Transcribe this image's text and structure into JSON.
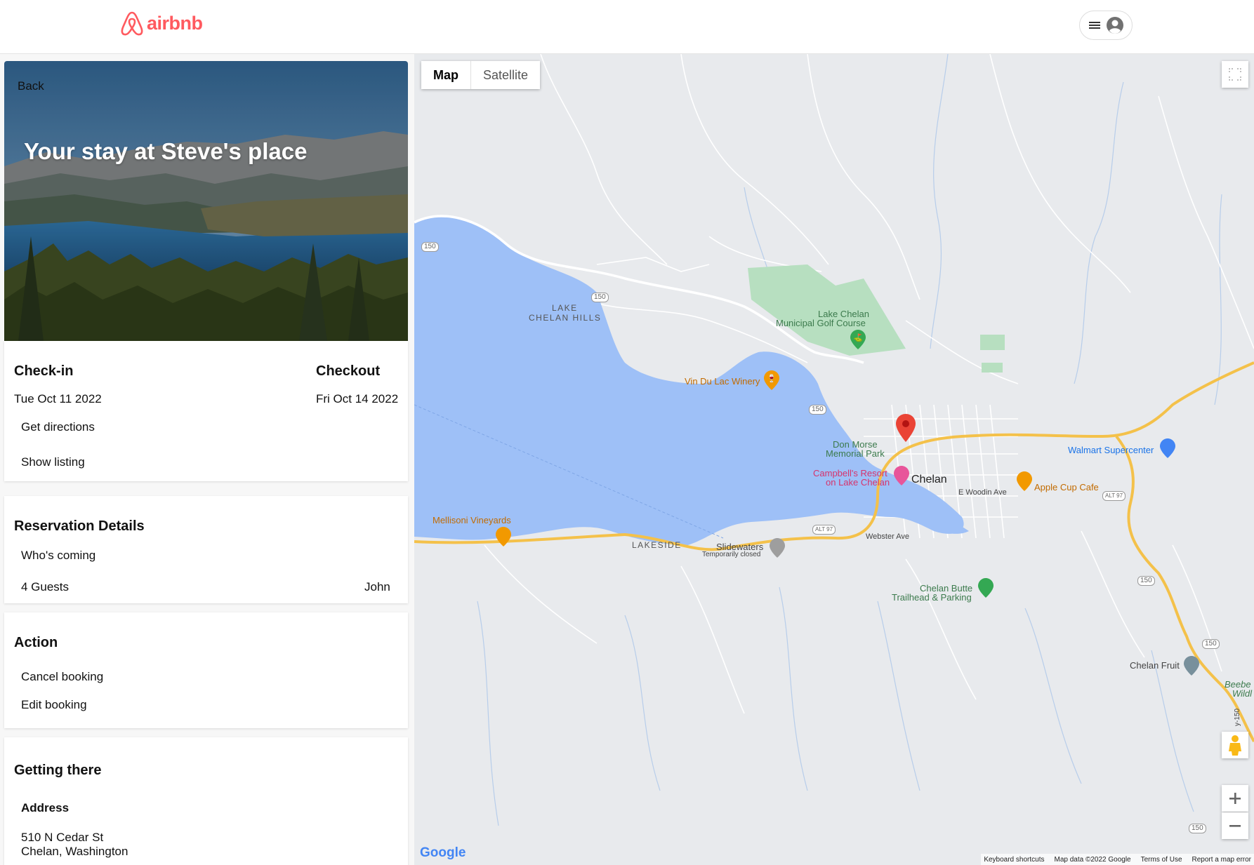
{
  "header": {
    "logo_text": "airbnb"
  },
  "stay": {
    "back_label": "Back",
    "title": "Your stay at Steve's place",
    "checkin_label": "Check-in",
    "checkin_date": "Tue Oct 11 2022",
    "checkout_label": "Checkout",
    "checkout_date": "Fri Oct 14 2022",
    "directions_link": "Get directions",
    "listing_link": "Show listing"
  },
  "reservation": {
    "heading": "Reservation Details",
    "whos_coming": "Who's coming",
    "guests": "4 Guests",
    "host": "John"
  },
  "action": {
    "heading": "Action",
    "cancel": "Cancel booking",
    "edit": "Edit booking"
  },
  "getting_there": {
    "heading": "Getting there",
    "address_label": "Address",
    "address_line1": "510 N Cedar St",
    "address_line2": "Chelan, Washington"
  },
  "map": {
    "tab_map": "Map",
    "tab_satellite": "Satellite",
    "labels": {
      "lake_chelan_hills_1": "LAKE",
      "lake_chelan_hills_2": "CHELAN HILLS",
      "golf_1": "Lake Chelan",
      "golf_2": "Municipal Golf Course",
      "winery": "Vin Du Lac Winery",
      "don_morse_1": "Don Morse",
      "don_morse_2": "Memorial Park",
      "campbells_1": "Campbell's Resort",
      "campbells_2": "on Lake Chelan",
      "chelan": "Chelan",
      "walmart": "Walmart Supercenter",
      "woodin": "E Woodin Ave",
      "apple_cup": "Apple Cup Cafe",
      "mellisoni": "Mellisoni Vineyards",
      "lakeside": "LAKESIDE",
      "slidewaters": "Slidewaters",
      "slidewaters_sub": "Temporarily closed",
      "webster": "Webster Ave",
      "butte_1": "Chelan Butte",
      "butte_2": "Trailhead & Parking",
      "chelan_fruit": "Chelan Fruit",
      "beebe_1": "Beebe",
      "beebe_2": "Wildl",
      "hwy_side": "y-150"
    },
    "road_shields": [
      "150",
      "150",
      "150",
      "ALT 97",
      "ALT 97",
      "150",
      "150",
      "150"
    ],
    "attribution": {
      "google": "Google",
      "shortcuts": "Keyboard shortcuts",
      "data": "Map data ©2022 Google",
      "terms": "Terms of Use",
      "report": "Report a map error"
    },
    "colors": {
      "water": "#9ec0f7",
      "land": "#e8eaed",
      "park": "#b7dfc0",
      "highway": "#f4c14a",
      "pin": "#ea4335"
    }
  }
}
